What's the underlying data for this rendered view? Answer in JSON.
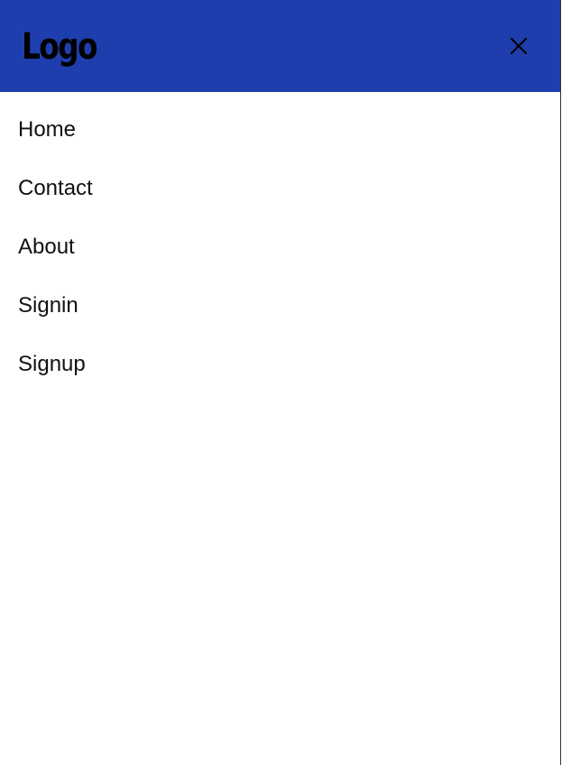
{
  "header": {
    "logo_text": "Logo",
    "background_color": "#1f3eae",
    "close_icon": "close-icon"
  },
  "nav": {
    "items": [
      {
        "label": "Home"
      },
      {
        "label": "Contact"
      },
      {
        "label": "About"
      },
      {
        "label": "Signin"
      },
      {
        "label": "Signup"
      }
    ]
  }
}
